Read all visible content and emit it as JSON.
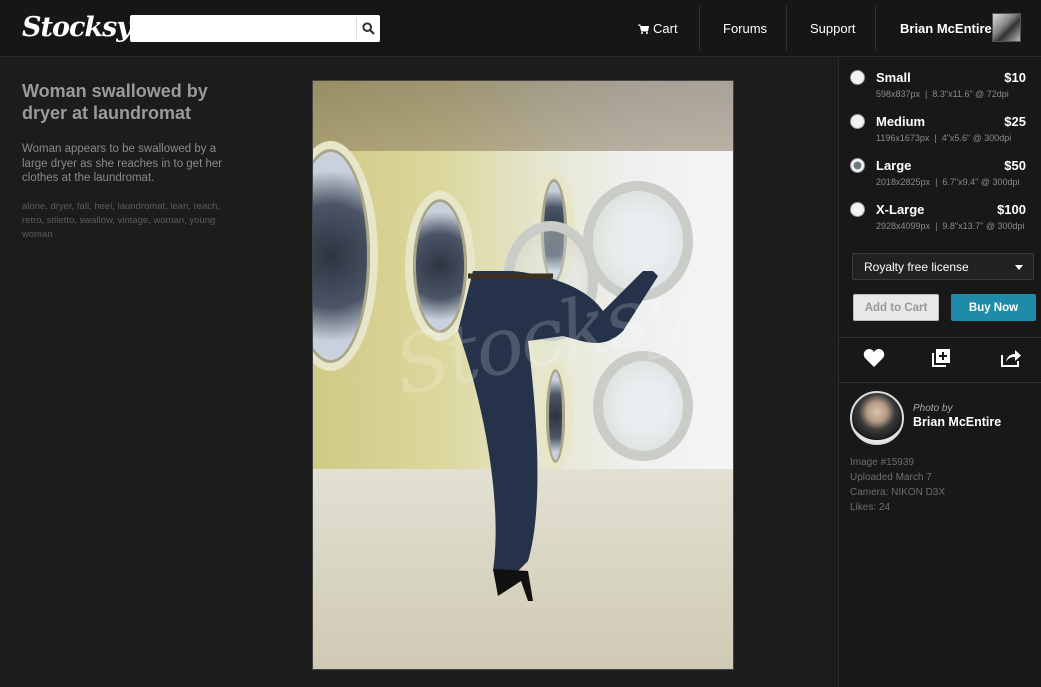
{
  "header": {
    "logo": "Stocksy",
    "search": {
      "value": "",
      "placeholder": ""
    },
    "nav": {
      "cart": "Cart",
      "forums": "Forums",
      "support": "Support",
      "user": "Brian McEntire"
    }
  },
  "photo": {
    "title": "Woman swallowed by dryer at laundromat",
    "description": "Woman appears to be swallowed by a large dryer as she reaches in to get her clothes at the laundromat.",
    "keywords": "alone, dryer, fall, heel, laundromat, lean, reach, retro, stiletto, swallow, vintage, woman, young woman"
  },
  "sizes": [
    {
      "name": "Small",
      "price": "$10",
      "pixels": "598x837px",
      "print": "8.3\"x11.6\" @ 72dpi",
      "selected": false
    },
    {
      "name": "Medium",
      "price": "$25",
      "pixels": "1196x1673px",
      "print": "4\"x5.6\" @ 300dpi",
      "selected": false
    },
    {
      "name": "Large",
      "price": "$50",
      "pixels": "2018x2825px",
      "print": "6.7\"x9.4\" @ 300dpi",
      "selected": true
    },
    {
      "name": "X-Large",
      "price": "$100",
      "pixels": "2928x4099px",
      "print": "9.8\"x13.7\" @ 300dpi",
      "selected": false
    }
  ],
  "license": {
    "selected": "Royalty free license"
  },
  "buttons": {
    "add_to_cart": "Add to Cart",
    "buy_now": "Buy Now"
  },
  "photographer": {
    "label": "Photo by",
    "name": "Brian McEntire",
    "image": "Image #15939",
    "uploaded": "Uploaded March 7",
    "camera": "Camera: NIKON D3X",
    "likes": "Likes: 24"
  },
  "colors": {
    "accent": "#1e8ba8",
    "background": "#1c1c1c",
    "header": "#161616"
  }
}
